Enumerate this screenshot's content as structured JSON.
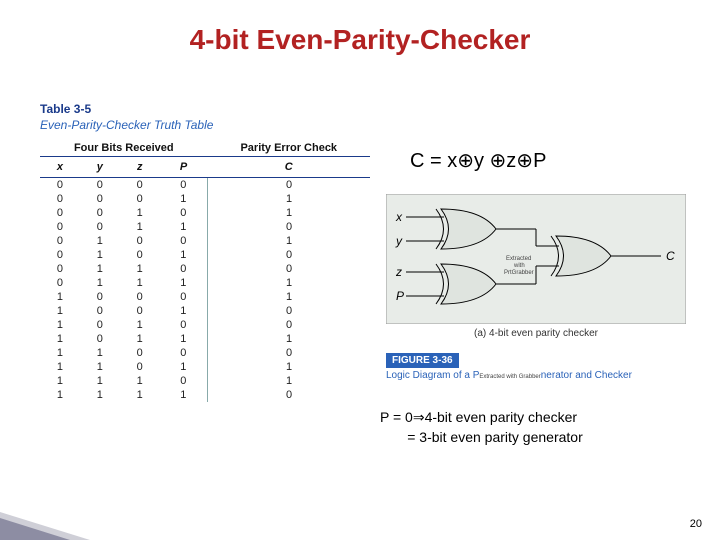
{
  "title": "4-bit Even-Parity-Checker",
  "table": {
    "number": "Table 3-5",
    "caption": "Even-Parity-Checker Truth Table",
    "group_heads": [
      "Four Bits Received",
      "Parity Error Check"
    ],
    "cols": [
      "x",
      "y",
      "z",
      "P",
      "C"
    ],
    "rows": [
      [
        "0",
        "0",
        "0",
        "0",
        "0"
      ],
      [
        "0",
        "0",
        "0",
        "1",
        "1"
      ],
      [
        "0",
        "0",
        "1",
        "0",
        "1"
      ],
      [
        "0",
        "0",
        "1",
        "1",
        "0"
      ],
      [
        "0",
        "1",
        "0",
        "0",
        "1"
      ],
      [
        "0",
        "1",
        "0",
        "1",
        "0"
      ],
      [
        "0",
        "1",
        "1",
        "0",
        "0"
      ],
      [
        "0",
        "1",
        "1",
        "1",
        "1"
      ],
      [
        "1",
        "0",
        "0",
        "0",
        "1"
      ],
      [
        "1",
        "0",
        "0",
        "1",
        "0"
      ],
      [
        "1",
        "0",
        "1",
        "0",
        "0"
      ],
      [
        "1",
        "0",
        "1",
        "1",
        "1"
      ],
      [
        "1",
        "1",
        "0",
        "0",
        "0"
      ],
      [
        "1",
        "1",
        "0",
        "1",
        "1"
      ],
      [
        "1",
        "1",
        "1",
        "0",
        "1"
      ],
      [
        "1",
        "1",
        "1",
        "1",
        "0"
      ]
    ]
  },
  "equation": "C = x⊕y ⊕z⊕P",
  "circuit": {
    "inputs": [
      "x",
      "y",
      "z",
      "P"
    ],
    "output": "C",
    "caption": "(a) 4-bit even parity checker",
    "watermark": "Extracted with PrtGrabber"
  },
  "figure": {
    "number": "FIGURE 3-36",
    "caption_prefix": "Logic Diagram of a P",
    "caption_suffix": "nerator and Checker",
    "watermark": "Extracted with Grabber"
  },
  "bottom": {
    "line1_pre": "P = 0",
    "line1_post": "4-bit even parity checker",
    "line2": "= 3-bit even parity generator"
  },
  "page": "20",
  "chart_data": {
    "type": "table",
    "title": "Even-Parity-Checker Truth Table",
    "columns": [
      "x",
      "y",
      "z",
      "P",
      "C"
    ],
    "rows": [
      [
        0,
        0,
        0,
        0,
        0
      ],
      [
        0,
        0,
        0,
        1,
        1
      ],
      [
        0,
        0,
        1,
        0,
        1
      ],
      [
        0,
        0,
        1,
        1,
        0
      ],
      [
        0,
        1,
        0,
        0,
        1
      ],
      [
        0,
        1,
        0,
        1,
        0
      ],
      [
        0,
        1,
        1,
        0,
        0
      ],
      [
        0,
        1,
        1,
        1,
        1
      ],
      [
        1,
        0,
        0,
        0,
        1
      ],
      [
        1,
        0,
        0,
        1,
        0
      ],
      [
        1,
        0,
        1,
        0,
        0
      ],
      [
        1,
        0,
        1,
        1,
        1
      ],
      [
        1,
        1,
        0,
        0,
        0
      ],
      [
        1,
        1,
        0,
        1,
        1
      ],
      [
        1,
        1,
        1,
        0,
        1
      ],
      [
        1,
        1,
        1,
        1,
        0
      ]
    ]
  }
}
